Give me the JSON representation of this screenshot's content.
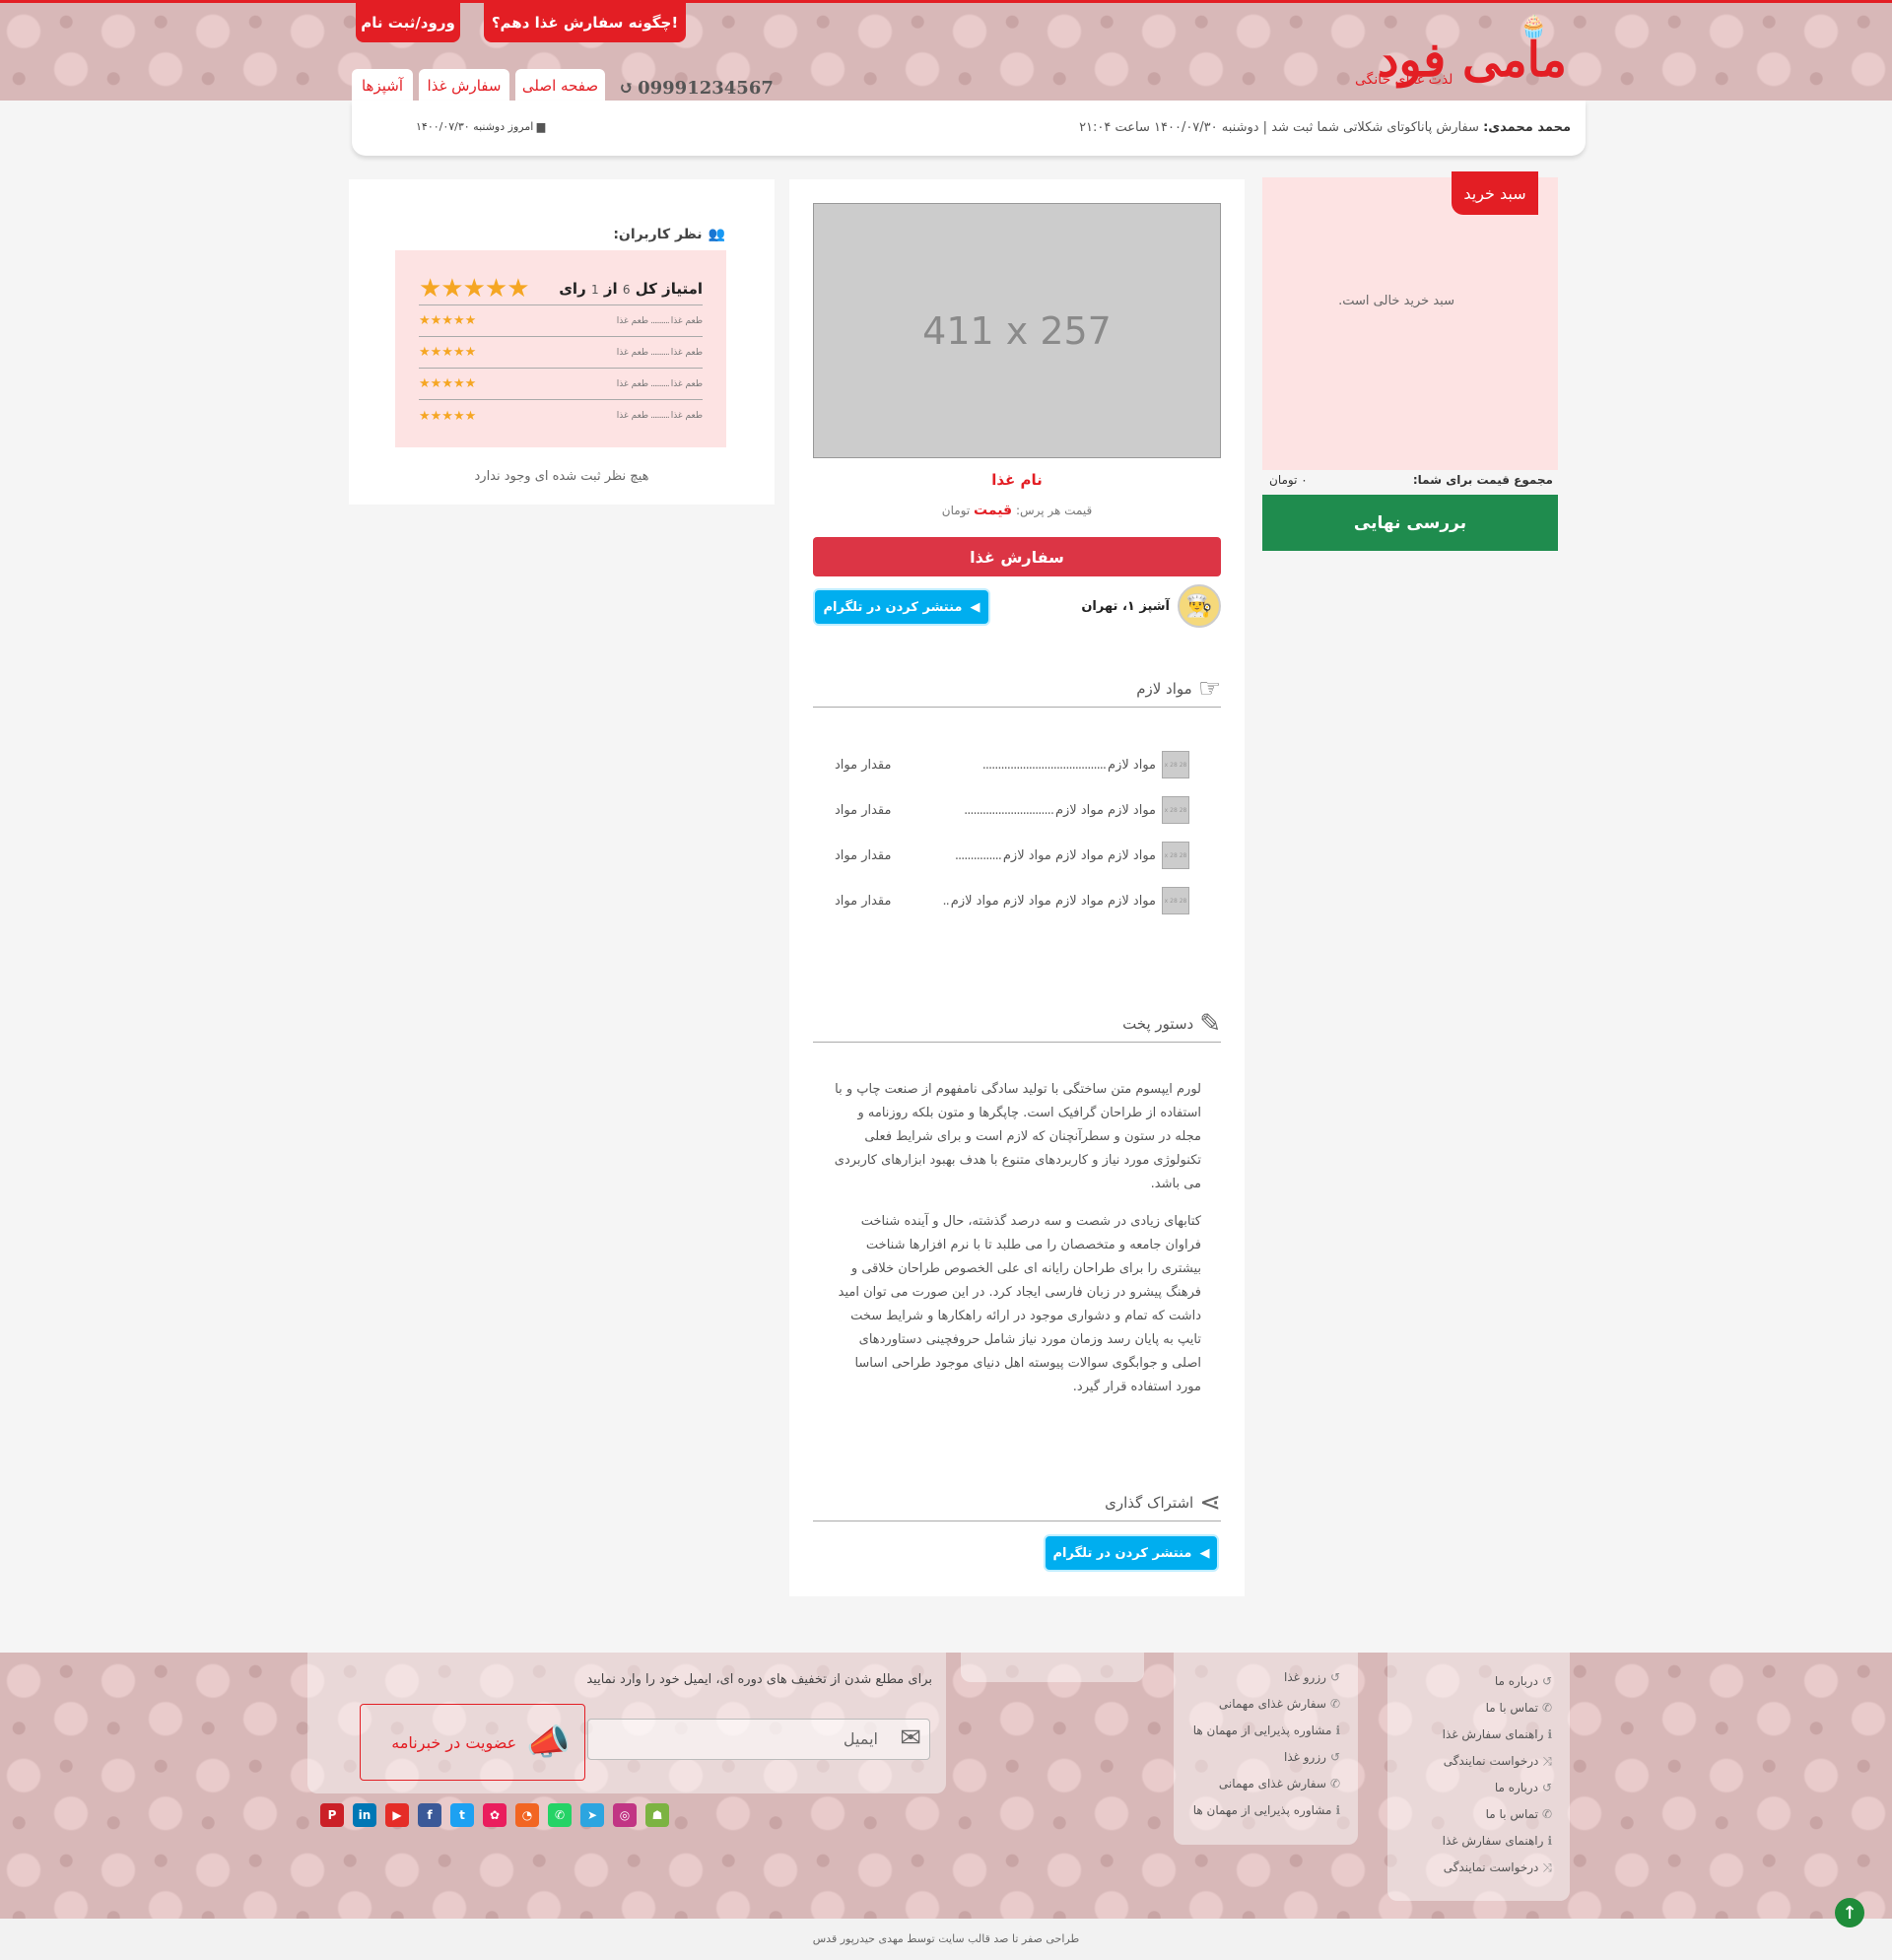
{
  "header": {
    "logo_main": "مامی فود",
    "logo_sub": "لذت غذای خانگی",
    "btn_how_to_order": "چگونه سفارش غذا دهم؟!",
    "btn_login": "ورود/ثبت نام",
    "phone": "09991234567",
    "phone_icon": "history-icon",
    "nav": [
      {
        "label": "صفحه اصلی"
      },
      {
        "label": "سفارش غذا"
      },
      {
        "label": "آشپزها"
      }
    ]
  },
  "newsbar": {
    "author": "محمد محمدی:",
    "message": "سفارش پاناکوتای شکلاتی شما ثبت شد | دوشنبه ۱۴۰۰/۰۷/۳۰ ساعت ۲۱:۰۴",
    "today_label": "امروز دوشنبه ۱۴۰۰/۰۷/۳۰",
    "today_icon": "calendar-icon"
  },
  "cart": {
    "title": "سبد خرید",
    "empty_text": "سبد خرید خالی است.",
    "total_label": "مجموع قیمت برای شما:",
    "total_value": "۰ تومان",
    "checkout_label": "بررسی نهایی",
    "bg_color": "#fde3e3",
    "checkout_color": "#1f8c4e"
  },
  "food": {
    "image_placeholder": "411 x 257",
    "name": "نام غذا",
    "price_prefix": "قیمت هر پرس:",
    "price_value": "قیمت",
    "price_unit": "تومان",
    "order_label": "سفارش غذا",
    "chef_name": "آشپز ۱، تهران",
    "chef_icon": "chef-hat-icon",
    "telegram_label": "منتشر کردن در تلگرام"
  },
  "ingredients": {
    "title": "مواد لازم",
    "icon": "hand-icon",
    "thumb_text": "28 x 28",
    "items": [
      {
        "name": "مواد لازم",
        "dots": "........................................",
        "amount": "مقدار مواد"
      },
      {
        "name": "مواد لازم مواد لازم",
        "dots": ".............................",
        "amount": "مقدار مواد"
      },
      {
        "name": "مواد لازم مواد لازم مواد لازم",
        "dots": "...............",
        "amount": "مقدار مواد"
      },
      {
        "name": "مواد لازم مواد لازم مواد لازم مواد لازم",
        "dots": "..",
        "amount": "مقدار مواد"
      }
    ]
  },
  "recipe": {
    "title": "دستور پخت",
    "icon": "pencil-icon",
    "p1": "لورم ایپسوم متن ساختگی با تولید سادگی نامفهوم از صنعت چاپ و با استفاده از طراحان گرافیک است. چاپگرها و متون بلکه روزنامه و مجله در ستون و سطرآنچنان که لازم است و برای شرایط فعلی تکنولوژی مورد نیاز و کاربردهای متنوع با هدف بهبود ابزارهای کاربردی می باشد.",
    "p2": "کتابهای زیادی در شصت و سه درصد گذشته، حال و آینده شناخت فراوان جامعه و متخصصان را می طلبد تا با نرم افزارها شناخت بیشتری را برای طراحان رایانه ای علی الخصوص طراحان خلاقی و فرهنگ پیشرو در زبان فارسی ایجاد کرد. در این صورت می توان امید داشت که تمام و دشواری موجود در ارائه راهکارها و شرایط سخت تایپ به پایان رسد وزمان مورد نیاز شامل حروفچینی دستاوردهای اصلی و جوابگوی سوالات پیوسته اهل دنیای موجود طراحی اساسا مورد استفاده قرار گیرد."
  },
  "share": {
    "title": "اشتراک گذاری",
    "icon": "share-icon",
    "telegram_label": "منتشر کردن در تلگرام"
  },
  "comments": {
    "title": "نظر کاربران:",
    "icon": "users-icon",
    "rating_title": "امتیاز کل",
    "rating_score": "6",
    "rating_of": "از",
    "rating_count": "1",
    "rating_unit": "رای",
    "stars": 5,
    "rows": [
      {
        "label": "طعم غذا",
        "dots": "..........",
        "label2": "طعم غذا",
        "stars": 5
      },
      {
        "label": "طعم غذا",
        "dots": "..........",
        "label2": "طعم غذا",
        "stars": 5
      },
      {
        "label": "طعم غذا",
        "dots": "..........",
        "label2": "طعم غذا",
        "stars": 5
      },
      {
        "label": "طعم غذا",
        "dots": "..........",
        "label2": "طعم غذا",
        "stars": 5
      }
    ],
    "empty": "هیچ نظر ثبت شده ای وجود ندارد"
  },
  "footer": {
    "col1": [
      {
        "icon": "history-icon",
        "label": "درباره ما"
      },
      {
        "icon": "phone-icon",
        "label": "تماس با ما"
      },
      {
        "icon": "info-icon",
        "label": "راهنمای سفارش غذا"
      },
      {
        "icon": "shuffle-icon",
        "label": "درخواست نمایندگی"
      },
      {
        "icon": "history-icon",
        "label": "درباره ما"
      },
      {
        "icon": "phone-icon",
        "label": "تماس با ما"
      },
      {
        "icon": "info-icon",
        "label": "راهنمای سفارش غذا"
      },
      {
        "icon": "shuffle-icon",
        "label": "درخواست نمایندگی"
      }
    ],
    "col2": [
      {
        "icon": "history-icon",
        "label": "رزرو غذا"
      },
      {
        "icon": "phone-icon",
        "label": "سفارش غذای مهمانی"
      },
      {
        "icon": "info-icon",
        "label": "مشاوره پذیرایی از مهمان ها"
      },
      {
        "icon": "history-icon",
        "label": "رزرو غذا"
      },
      {
        "icon": "phone-icon",
        "label": "سفارش غذای مهمانی"
      },
      {
        "icon": "info-icon",
        "label": "مشاوره پذیرایی از مهمان ها"
      }
    ],
    "newsletter_text": "برای مطلع شدن از تخفیف های دوره ای، ایمیل خود را وارد نمایید",
    "email_placeholder": "ایمیل",
    "subscribe_label": "عضویت در خبرنامه",
    "socials": [
      {
        "name": "pinterest-icon",
        "glyph": "P",
        "color": "#cb2027"
      },
      {
        "name": "linkedin-icon",
        "glyph": "in",
        "color": "#0077b5"
      },
      {
        "name": "youtube-icon",
        "glyph": "▶",
        "color": "#e52d27"
      },
      {
        "name": "facebook-icon",
        "glyph": "f",
        "color": "#3b5998"
      },
      {
        "name": "twitter-icon",
        "glyph": "t",
        "color": "#1da1f2"
      },
      {
        "name": "aparat-icon",
        "glyph": "✿",
        "color": "#ea1d5d"
      },
      {
        "name": "rss-icon",
        "glyph": "◔",
        "color": "#f26522"
      },
      {
        "name": "whatsapp-icon",
        "glyph": "✆",
        "color": "#25d366"
      },
      {
        "name": "telegram-icon",
        "glyph": "➤",
        "color": "#2ca5e0"
      },
      {
        "name": "instagram-icon",
        "glyph": "◎",
        "color": "#c13584"
      },
      {
        "name": "android-icon",
        "glyph": "☗",
        "color": "#7cb342"
      }
    ],
    "copyright": "طراحی صفر تا صد قالب سایت توسط مهدی حیدرپور قدس",
    "to_top_icon": "arrow-up-icon"
  },
  "colors": {
    "brand": "#e31e24",
    "accent_green": "#1f8c4e",
    "telegram": "#00aeef",
    "star": "#f5a623"
  }
}
